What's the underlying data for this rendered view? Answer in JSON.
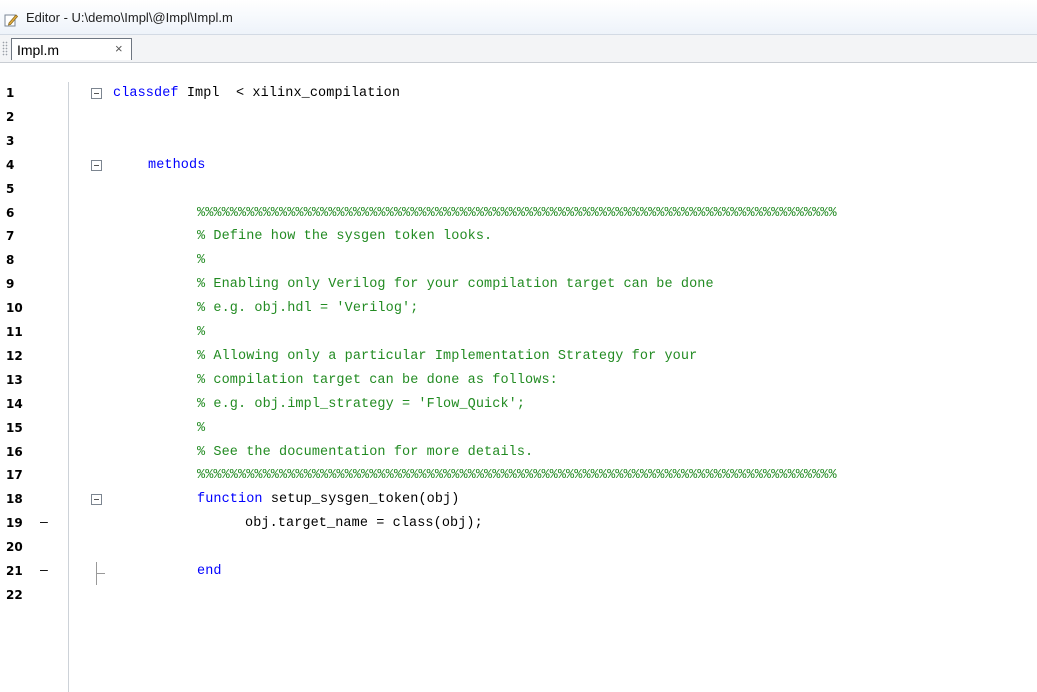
{
  "window": {
    "title": "Editor - U:\\demo\\Impl\\@Impl\\Impl.m",
    "icon": "editor-pencil-icon"
  },
  "tabs": [
    {
      "label": "Impl.m",
      "close": "×"
    }
  ],
  "colors": {
    "keyword": "#0000ff",
    "comment": "#228b22",
    "string": "#a020f0"
  },
  "lines": [
    {
      "num": "1",
      "bp": "",
      "fold": "open",
      "indent": 0,
      "parts": [
        {
          "t": "classdef",
          "c": "kw"
        },
        {
          "t": " Impl  < xilinx_compilation",
          "c": ""
        }
      ]
    },
    {
      "num": "2",
      "bp": "",
      "fold": "",
      "indent": 0,
      "parts": []
    },
    {
      "num": "3",
      "bp": "",
      "fold": "",
      "indent": 0,
      "parts": []
    },
    {
      "num": "4",
      "bp": "",
      "fold": "open",
      "indent": 1,
      "parts": [
        {
          "t": "methods",
          "c": "kw"
        }
      ]
    },
    {
      "num": "5",
      "bp": "",
      "fold": "",
      "indent": 0,
      "parts": []
    },
    {
      "num": "6",
      "bp": "",
      "fold": "",
      "indent": 2,
      "parts": [
        {
          "t": "%%%%%%%%%%%%%%%%%%%%%%%%%%%%%%%%%%%%%%%%%%%%%%%%%%%%%%%%%%%%%%%%%%%%%%%%%%%%%%",
          "c": "cm"
        }
      ]
    },
    {
      "num": "7",
      "bp": "",
      "fold": "",
      "indent": 2,
      "parts": [
        {
          "t": "% Define how the sysgen token looks.",
          "c": "cm"
        }
      ]
    },
    {
      "num": "8",
      "bp": "",
      "fold": "",
      "indent": 2,
      "parts": [
        {
          "t": "%",
          "c": "cm"
        }
      ]
    },
    {
      "num": "9",
      "bp": "",
      "fold": "",
      "indent": 2,
      "parts": [
        {
          "t": "% Enabling only Verilog for your compilation target can be done",
          "c": "cm"
        }
      ]
    },
    {
      "num": "10",
      "bp": "",
      "fold": "",
      "indent": 2,
      "parts": [
        {
          "t": "% e.g. obj.hdl = 'Verilog';",
          "c": "cm"
        }
      ]
    },
    {
      "num": "11",
      "bp": "",
      "fold": "",
      "indent": 2,
      "parts": [
        {
          "t": "%",
          "c": "cm"
        }
      ]
    },
    {
      "num": "12",
      "bp": "",
      "fold": "",
      "indent": 2,
      "parts": [
        {
          "t": "% Allowing only a particular Implementation Strategy for your",
          "c": "cm"
        }
      ]
    },
    {
      "num": "13",
      "bp": "",
      "fold": "",
      "indent": 2,
      "parts": [
        {
          "t": "% compilation target can be done as follows:",
          "c": "cm"
        }
      ]
    },
    {
      "num": "14",
      "bp": "",
      "fold": "",
      "indent": 2,
      "parts": [
        {
          "t": "% e.g. obj.impl_strategy = 'Flow_Quick';",
          "c": "cm"
        }
      ]
    },
    {
      "num": "15",
      "bp": "",
      "fold": "",
      "indent": 2,
      "parts": [
        {
          "t": "%",
          "c": "cm"
        }
      ]
    },
    {
      "num": "16",
      "bp": "",
      "fold": "",
      "indent": 2,
      "parts": [
        {
          "t": "% See the documentation for more details.",
          "c": "cm"
        }
      ]
    },
    {
      "num": "17",
      "bp": "",
      "fold": "",
      "indent": 2,
      "parts": [
        {
          "t": "%%%%%%%%%%%%%%%%%%%%%%%%%%%%%%%%%%%%%%%%%%%%%%%%%%%%%%%%%%%%%%%%%%%%%%%%%%%%%%",
          "c": "cm"
        }
      ]
    },
    {
      "num": "18",
      "bp": "",
      "fold": "open",
      "indent": 2,
      "parts": [
        {
          "t": "function",
          "c": "kw"
        },
        {
          "t": " setup_sysgen_token(obj)",
          "c": ""
        }
      ]
    },
    {
      "num": "19",
      "bp": "–",
      "fold": "",
      "indent": 3,
      "parts": [
        {
          "t": "obj.target_name = class(obj);",
          "c": ""
        }
      ]
    },
    {
      "num": "20",
      "bp": "",
      "fold": "",
      "indent": 0,
      "parts": []
    },
    {
      "num": "21",
      "bp": "–",
      "fold": "end",
      "indent": 2,
      "parts": [
        {
          "t": "end",
          "c": "kw"
        }
      ]
    },
    {
      "num": "22",
      "bp": "",
      "fold": "",
      "indent": 0,
      "parts": []
    }
  ]
}
